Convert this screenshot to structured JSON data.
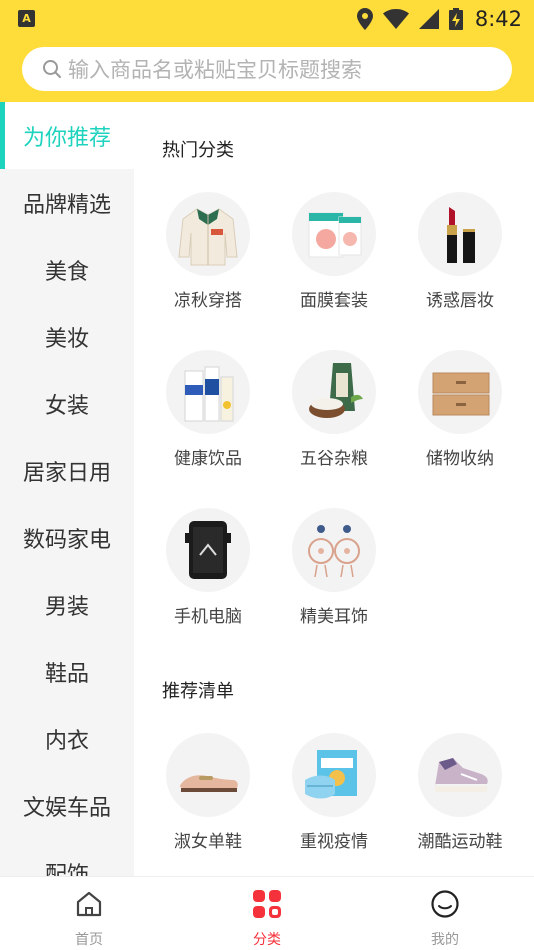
{
  "status_bar": {
    "left_icon": "A",
    "time": "8:42",
    "icons": [
      "location-icon",
      "wifi-icon",
      "signal-icon",
      "battery-charging-icon"
    ]
  },
  "search": {
    "placeholder": "输入商品名或粘贴宝贝标题搜索"
  },
  "sidebar": {
    "items": [
      {
        "label": "为你推荐",
        "active": true
      },
      {
        "label": "品牌精选"
      },
      {
        "label": "美食"
      },
      {
        "label": "美妆"
      },
      {
        "label": "女装"
      },
      {
        "label": "居家日用"
      },
      {
        "label": "数码家电"
      },
      {
        "label": "男装"
      },
      {
        "label": "鞋品"
      },
      {
        "label": "内衣"
      },
      {
        "label": "文娱车品"
      },
      {
        "label": "配饰"
      }
    ]
  },
  "hot_categories": {
    "title": "热门分类",
    "items": [
      {
        "label": "凉秋穿搭",
        "icon": "jacket-image"
      },
      {
        "label": "面膜套装",
        "icon": "face-mask-box-image"
      },
      {
        "label": "诱惑唇妆",
        "icon": "lipstick-image"
      },
      {
        "label": "健康饮品",
        "icon": "drink-bottles-image"
      },
      {
        "label": "五谷杂粮",
        "icon": "rice-bag-image"
      },
      {
        "label": "储物收纳",
        "icon": "storage-drawer-image"
      },
      {
        "label": "手机电脑",
        "icon": "rugged-phone-image"
      },
      {
        "label": "精美耳饰",
        "icon": "earrings-image"
      }
    ]
  },
  "recommend_list": {
    "title": "推荐清单",
    "items": [
      {
        "label": "淑女单鞋",
        "icon": "loafer-shoe-image"
      },
      {
        "label": "重视疫情",
        "icon": "medical-mask-box-image"
      },
      {
        "label": "潮酷运动鞋",
        "icon": "sneaker-image"
      }
    ]
  },
  "tabbar": {
    "items": [
      {
        "label": "首页",
        "icon": "home-icon"
      },
      {
        "label": "分类",
        "icon": "category-grid-icon",
        "active": true
      },
      {
        "label": "我的",
        "icon": "profile-smile-icon"
      }
    ]
  },
  "colors": {
    "header_yellow": "#FEDC3A",
    "active_teal": "#1ED3BE",
    "tab_active_red": "#F5323C"
  }
}
